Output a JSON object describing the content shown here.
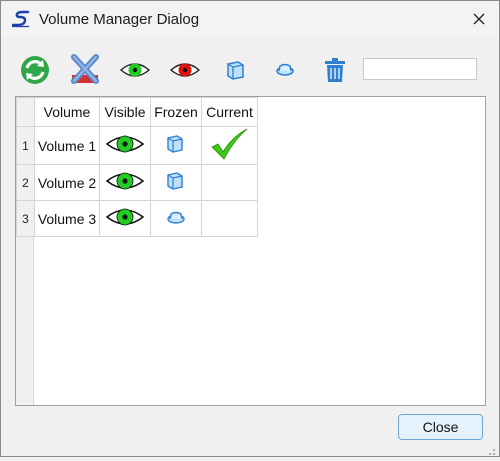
{
  "window": {
    "title": "Volume Manager Dialog",
    "close_glyph": "✕",
    "logo_icon": "app-logo-s"
  },
  "toolbar": {
    "buttons": [
      {
        "name": "refresh-button",
        "icon": "refresh-icon"
      },
      {
        "name": "delete-volume-button",
        "icon": "x-delete-icon"
      },
      {
        "name": "show-button",
        "icon": "eye-green-icon"
      },
      {
        "name": "hide-button",
        "icon": "eye-red-icon"
      },
      {
        "name": "freeze-button",
        "icon": "frozen-cube-icon"
      },
      {
        "name": "thaw-button",
        "icon": "thawed-cube-icon"
      },
      {
        "name": "trash-button",
        "icon": "trash-icon"
      }
    ],
    "search": {
      "value": "",
      "placeholder": ""
    }
  },
  "table": {
    "columns": [
      "Volume",
      "Visible",
      "Frozen",
      "Current"
    ],
    "rows": [
      {
        "index": "1",
        "volume": "Volume 1",
        "visible": "eye-green-icon",
        "frozen": "frozen-cube-icon",
        "current": true
      },
      {
        "index": "2",
        "volume": "Volume 2",
        "visible": "eye-green-icon",
        "frozen": "frozen-cube-icon",
        "current": false
      },
      {
        "index": "3",
        "volume": "Volume 3",
        "visible": "eye-green-icon",
        "frozen": "thawed-cube-icon",
        "current": false
      }
    ]
  },
  "footer": {
    "close_label": "Close"
  },
  "colors": {
    "eye_green": "#22cc22",
    "eye_red": "#e01010",
    "check_green": "#3ccc14",
    "accent_blue": "#2f7fd1"
  }
}
